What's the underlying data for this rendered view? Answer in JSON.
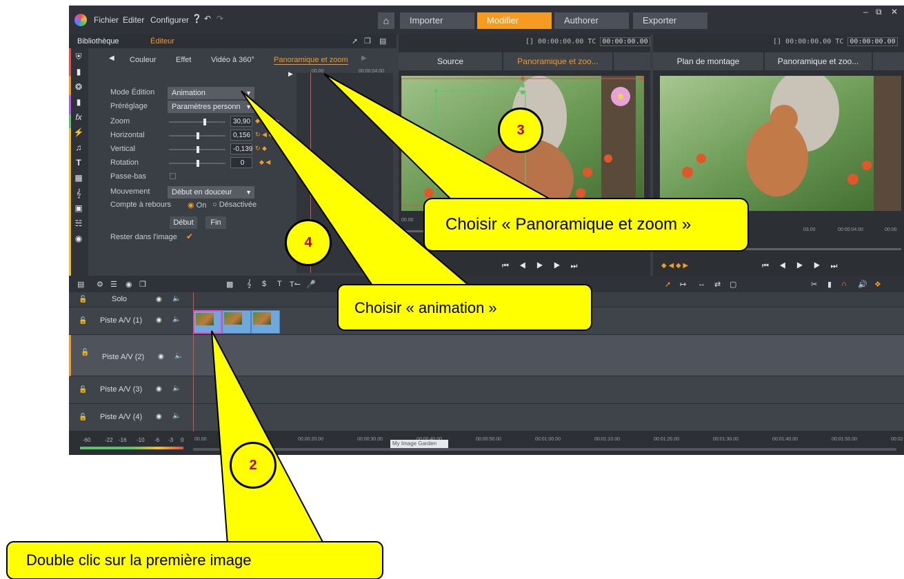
{
  "menubar": {
    "menus": [
      "Fichier",
      "Editer",
      "Configurer"
    ],
    "modes": [
      "Importer",
      "Modifier",
      "Authorer",
      "Exporter"
    ],
    "active_mode": "Modifier"
  },
  "left_panel": {
    "bibliotheque": "Bibliothèque",
    "editeur": "Éditeur",
    "tabs": [
      "Couleur",
      "Effet",
      "Vidéo à 360°",
      "Panoramique et zoom"
    ],
    "ruler_start": ":00.00",
    "ruler_end": "00:00:04.00",
    "mode_label": "Mode Édition",
    "mode_value": "Animation",
    "preset_label": "Préréglage",
    "preset_value": "Paramètres personn",
    "zoom_label": "Zoom",
    "zoom_value": "30,90",
    "horizontal_label": "Horizontal",
    "horizontal_value": "0,156",
    "vertical_label": "Vertical",
    "vertical_value": "-0,139",
    "rotation_label": "Rotation",
    "rotation_value": "0",
    "passebas_label": "Passe-bas",
    "mouvement_label": "Mouvement",
    "mouvement_value": "Début en douceur",
    "compte_label": "Compte à rebours",
    "on_label": "On",
    "off_label": "Désactivée",
    "debut_btn": "Début",
    "fin_btn": "Fin",
    "rester_label": "Rester dans l'image"
  },
  "source_monitor": {
    "timecode": "[] 00:00:00.00",
    "tc_label": "TC",
    "tc_value": "00:00:00.00",
    "tab_source": "Source",
    "tab_pan": "Panoramique et zoo...",
    "scrub_start": "00.00"
  },
  "timeline_monitor": {
    "timecode": "[] 00:00:00.00",
    "tc_label": "TC",
    "tc_value": "00:00:00.00",
    "tab_plan": "Plan de montage",
    "tab_pan": "Panoramique et zoo...",
    "ruler_labels": [
      "03.00",
      "00:00:04.00",
      "00:00"
    ]
  },
  "timeline": {
    "tracks": [
      {
        "name": "Solo"
      },
      {
        "name": "Piste A/V (1)"
      },
      {
        "name": "Piste A/V (2)"
      },
      {
        "name": "Piste A/V (3)"
      },
      {
        "name": "Piste A/V (4)"
      }
    ],
    "vu_labels": [
      "-60",
      "-22",
      "-16",
      "-10",
      "-6",
      "-3",
      "0"
    ],
    "ruler_labels": [
      "00.00",
      "00:00:20.00",
      "00:00:30.00",
      "00:00:40.00",
      "00:00:50.00",
      "00:01:00.00",
      "00:01:10.00",
      "00:01:20.00",
      "00:01:30.00",
      "00:01:40.00",
      "00:01:50.00",
      "00:02"
    ],
    "tooltip": "My Image Garden"
  },
  "callouts": {
    "pan_zoom": "Choisir « Panoramique et zoom »",
    "animation": "Choisir « animation »",
    "double_click": "Double clic sur la première image",
    "badge2": "2",
    "badge3": "3",
    "badge4": "4"
  },
  "colors": {
    "accent": "#f59b22",
    "callout_fill": "#ffff00",
    "badge_number": "#c00000",
    "clip": "#6fa8dc"
  }
}
